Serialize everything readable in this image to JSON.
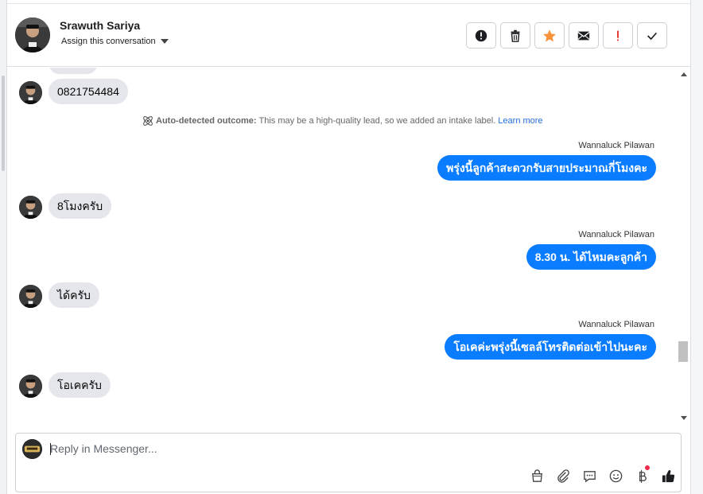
{
  "contact": {
    "name": "Srawuth Sariya",
    "assign_label": "Assign this conversation"
  },
  "header_actions": [
    {
      "name": "spam-button",
      "icon": "alert-circle-icon"
    },
    {
      "name": "delete-button",
      "icon": "trash-icon"
    },
    {
      "name": "star-button",
      "icon": "star-icon",
      "color": "#f7923b"
    },
    {
      "name": "mark-unread-button",
      "icon": "envelope-icon"
    },
    {
      "name": "follow-up-button",
      "icon": "exclamation-icon",
      "color": "#e4281c"
    },
    {
      "name": "mark-done-button",
      "icon": "checkmark-icon"
    }
  ],
  "messages": {
    "in_phone": "0821754484",
    "outcome": {
      "label": "Auto-detected outcome:",
      "text": "This may be a high-quality lead, so we added an intake label.",
      "link": "Learn more"
    },
    "out_1_sender": "Wannaluck Pilawan",
    "out_1_text": "พรุ่งนี้ลูกค้าสะดวกรับสายประมาณกี่โมงคะ",
    "in_2": "8โมงครับ",
    "out_2_sender": "Wannaluck Pilawan",
    "out_2_text": "8.30 น. ได้ไหมคะลูกค้า",
    "in_3": "ได้ครับ",
    "out_3_sender": "Wannaluck Pilawan",
    "out_3_text": "โอเคค่ะพรุ่งนี้เซลล์โทรติดต่อเข้าไปนะคะ",
    "in_4": "โอเคครับ"
  },
  "composer": {
    "placeholder": "Reply in Messenger...",
    "tools": [
      "shopping-bag-icon",
      "paperclip-icon",
      "saved-reply-icon",
      "emoji-icon",
      "baht-payment-icon",
      "thumbs-up-icon"
    ]
  },
  "colors": {
    "outgoing": "#0a7cff",
    "incoming": "#e4e6eb",
    "link": "#216fdb"
  }
}
